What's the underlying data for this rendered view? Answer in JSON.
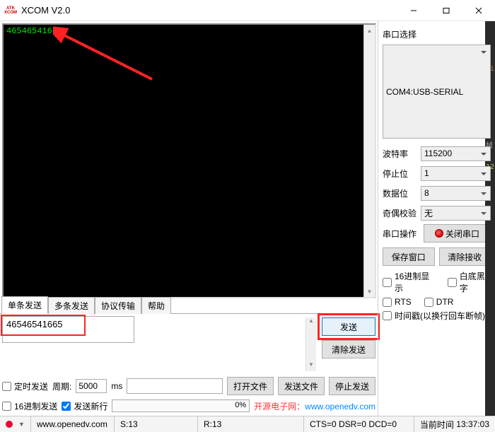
{
  "window": {
    "title": "XCOM V2.0"
  },
  "console": {
    "output": "46546541665"
  },
  "tabs": [
    {
      "label": "单条发送",
      "active": true
    },
    {
      "label": "多条发送",
      "active": false
    },
    {
      "label": "协议传输",
      "active": false
    },
    {
      "label": "帮助",
      "active": false
    }
  ],
  "send": {
    "text": "46546541665",
    "btn_send": "发送",
    "btn_clear": "清除发送",
    "timed_label": "定时发送",
    "period_label": "周期:",
    "period_value": "5000",
    "period_unit": "ms",
    "hex_send_label": "16进制发送",
    "newline_label": "发送新行",
    "newline_checked": true,
    "open_file": "打开文件",
    "send_file": "发送文件",
    "stop_send": "停止发送",
    "progress": "0%",
    "watermark_pre": "开源电子网：",
    "watermark_url": "www.openedv.com"
  },
  "right": {
    "heading": "串口选择",
    "port_value": "COM4:USB-SERIAL",
    "baud_label": "波特率",
    "baud_value": "115200",
    "stop_label": "停止位",
    "stop_value": "1",
    "data_label": "数据位",
    "data_value": "8",
    "parity_label": "奇偶校验",
    "parity_value": "无",
    "op_label": "串口操作",
    "op_btn": "关闭串口",
    "save_win": "保存窗口",
    "clear_rx": "清除接收",
    "hex_show": "16进制显示",
    "white_black": "白底黑字",
    "rts": "RTS",
    "dtr": "DTR",
    "timestamp": "时间戳(以换行回车断帧)"
  },
  "status": {
    "url": "www.openedv.com",
    "s": "S:13",
    "r": "R:13",
    "line": "CTS=0 DSR=0 DCD=0",
    "time_label": "当前时间",
    "time_value": "13:37:03"
  }
}
